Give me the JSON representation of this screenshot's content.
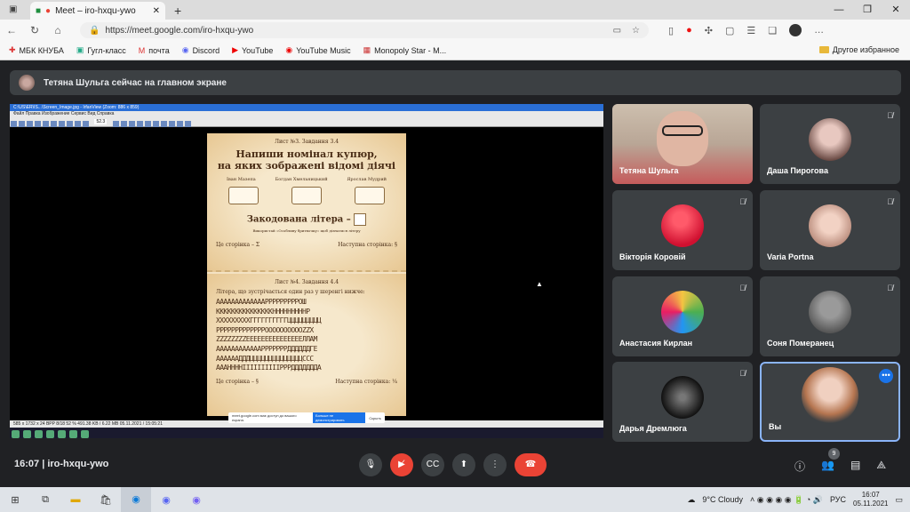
{
  "browser": {
    "tab_title": "Meet – iro-hxqu-ywo",
    "url": "https://meet.google.com/iro-hxqu-ywo",
    "new_tab": "+",
    "bookmarks": [
      "МБК КНУБА",
      "Гугл-класс",
      "почта",
      "Discord",
      "YouTube",
      "YouTube Music",
      "Monopoly Star - M..."
    ],
    "other_bookmarks": "Другое избранное"
  },
  "meet": {
    "banner_text": "Тетяна Шульга сейчас на главном экране",
    "shared": {
      "window_title": "C:\\US\\ER\\IS...\\Screen_Image.jpg - IrfanView (Zoom: 886 x 859)",
      "menu": "Файл  Правка  Изображение  Сервис  Вид  Справка",
      "zoom_field": "52.3",
      "status": "585 x 1732 x 24 BPP   8/18   52 %   491.38 KB / 6.22 MB   05.11.2021 / 15:05:21",
      "page1": {
        "header": "Лист №3. Завдання 3.4",
        "title_line1": "Напиши номінал купюр,",
        "title_line2": "на яких зображені відомі діячі",
        "names": [
          "Іван Мазепа",
          "Богдан Хмельницький",
          "Ярослав Мудрий"
        ],
        "code_label": "Закодована літера –",
        "fine": "Використай «Особливу бритвочку» щоб дізнатися літеру",
        "foot_left": "Це сторінка – Σ",
        "foot_right": "Наступна сторінка: §"
      },
      "page2": {
        "header": "Лист №4. Завдання 4.4",
        "task": "Літера, що зустрічається один раз у шеренгі нижче:",
        "lines": [
          "АААААААААААААРРРРРРРРРОШ",
          "КККККККККККККККНННННННННР",
          "ХХХХХХХХХГГГГГГГГГГЦЦЦЦЦЦЦЦЦ",
          "РРРРРРРРРРРРРООООООООООZZХ",
          "ZZZZZZZZEEEEEEEEEEEEЕЕЕЛЛАМ",
          "ААААААААААААРРРРРРРДДДДДДГЕ",
          "ААААААДДДЦЦЦЦЦЦЦЦЦЦЦЦЦЦССС",
          "АААННННІІІІІІІІІІРРРДДДДДДДА"
        ],
        "foot_left": "Це сторінка – §",
        "foot_right": "Наступна сторінка: ¼"
      },
      "notice": "meet.google.com має доступ до вашого екрана.",
      "notice_button": "Больше не демонстрировать",
      "notice_hide": "Скрыть"
    },
    "participants": [
      {
        "name": "Тетяна Шульга",
        "muted": false
      },
      {
        "name": "Даша Пирогова",
        "muted": true
      },
      {
        "name": "Вікторія Коровій",
        "muted": true
      },
      {
        "name": "Varia Portna",
        "muted": true
      },
      {
        "name": "Анастасия Кирлан",
        "muted": true
      },
      {
        "name": "Соня Померанец",
        "muted": true
      },
      {
        "name": "Дарья Дремлюга",
        "muted": true
      },
      {
        "name": "Вы",
        "muted": false
      }
    ],
    "bottom": {
      "time_code": "16:07  |  iro-hxqu-ywo",
      "people_count": "9"
    }
  },
  "taskbar": {
    "weather": "9°C  Cloudy",
    "lang": "РУС",
    "time": "16:07",
    "date": "05.11.2021"
  },
  "colors": {
    "meet_bg": "#202124",
    "tile_bg": "#3c4043",
    "end_call": "#ea4335",
    "accent": "#8ab4f8"
  }
}
